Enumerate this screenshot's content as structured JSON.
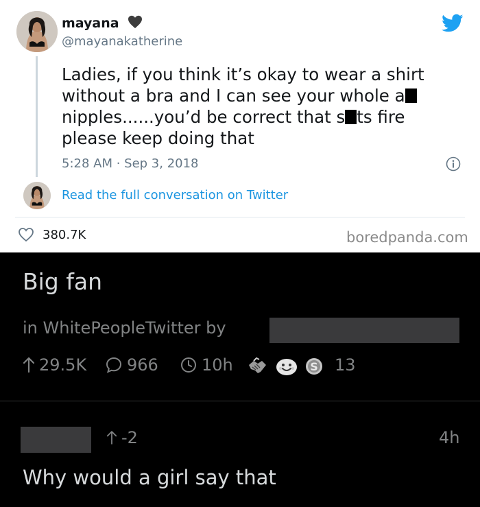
{
  "tweet": {
    "display_name": "mayana",
    "handle": "@mayanakatherine",
    "text_line1": "Ladies, if you think it’s okay to wear a shirt",
    "text_line2_part1": "without a bra and I can see your whole a",
    "text_line3_part1": "nipples......you’d be correct that s",
    "text_line3_part2": "ts fire",
    "text_line4": "please keep doing that",
    "timestamp": "5:28 AM · Sep 3, 2018",
    "read_link": "Read the full conversation on Twitter",
    "like_count": "380.7K",
    "watermark": "boredpanda.com",
    "colors": {
      "link": "#1b95e0",
      "secondary": "#657786",
      "text": "#14171a"
    }
  },
  "reddit_post": {
    "title": "Big fan",
    "meta_in": "in",
    "subreddit": "WhitePeopleTwitter",
    "meta_by": "by",
    "upvotes": "29.5K",
    "comments": "966",
    "age": "10h",
    "awards_count": "13",
    "icons": [
      "upvote-arrow-icon",
      "comment-bubble-icon",
      "clock-icon",
      "handshake-award-icon",
      "wholesome-award-icon",
      "silver-award-icon"
    ]
  },
  "comment": {
    "score": "-2",
    "age": "4h",
    "body": "Why would a girl say that"
  }
}
